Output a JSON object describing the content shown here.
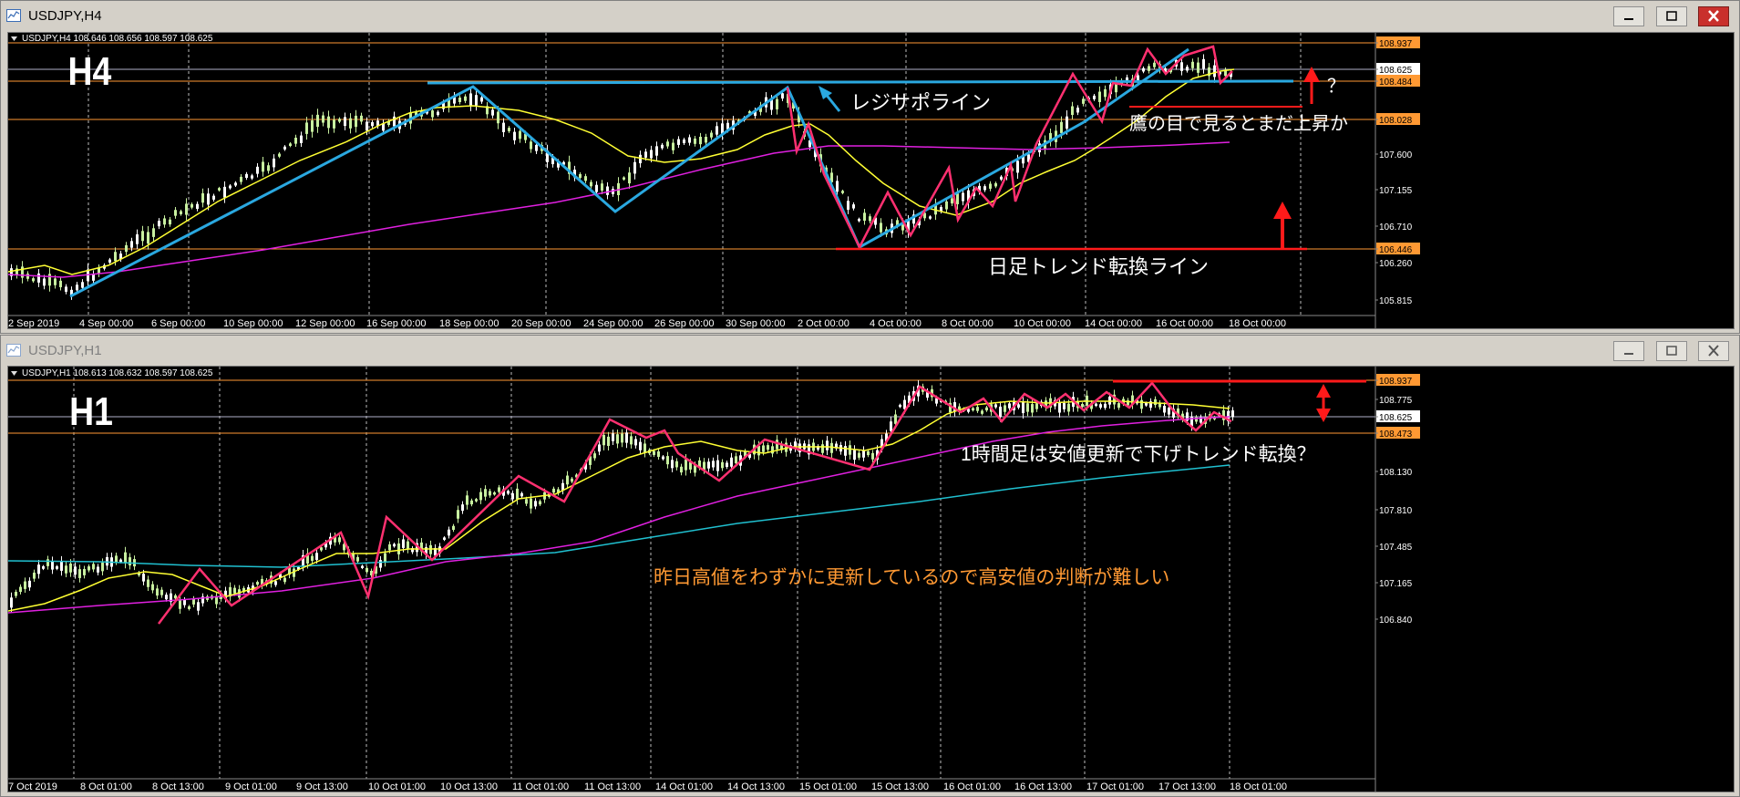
{
  "windows": [
    {
      "title": "USDJPY,H4",
      "header": "USDJPY,H4  108.646 108.656 108.597 108.625",
      "label": "H4",
      "price_labels": [
        "108.937",
        "108.625",
        "108.484",
        "108.028",
        "107.600",
        "107.155",
        "106.710",
        "106.446",
        "106.260",
        "105.815"
      ],
      "time_labels": [
        "2 Sep 2019",
        "4 Sep 00:00",
        "6 Sep 00:00",
        "10 Sep 00:00",
        "12 Sep 00:00",
        "16 Sep 00:00",
        "18 Sep 00:00",
        "20 Sep 00:00",
        "24 Sep 00:00",
        "26 Sep 00:00",
        "30 Sep 00:00",
        "2 Oct 00:00",
        "4 Oct 00:00",
        "8 Oct 00:00",
        "10 Oct 00:00",
        "14 Oct 00:00",
        "16 Oct 00:00",
        "18 Oct 00:00"
      ],
      "annotations": {
        "resistance": "レジサポライン",
        "hawk": "鷹の目で見るとまだ上昇か",
        "question": "？",
        "daily": "日足トレンド転換ライン"
      }
    },
    {
      "title": "USDJPY,H1",
      "header": "USDJPY,H1  108.613 108.632 108.597 108.625",
      "label": "H1",
      "price_labels": [
        "108.937",
        "108.775",
        "108.625",
        "108.473",
        "108.130",
        "107.810",
        "107.485",
        "107.165",
        "106.840"
      ],
      "time_labels": [
        "7 Oct 2019",
        "8 Oct 01:00",
        "8 Oct 13:00",
        "9 Oct 01:00",
        "9 Oct 13:00",
        "10 Oct 01:00",
        "10 Oct 13:00",
        "11 Oct 01:00",
        "11 Oct 13:00",
        "14 Oct 01:00",
        "14 Oct 13:00",
        "15 Oct 01:00",
        "15 Oct 13:00",
        "16 Oct 01:00",
        "16 Oct 13:00",
        "17 Oct 01:00",
        "17 Oct 13:00",
        "18 Oct 01:00"
      ],
      "annotations": {
        "h1note": "1時間足は安値更新で下げトレンド転換？",
        "yesterday": "昨日高値をわずかに更新しているので高安値の判断が難しい"
      }
    }
  ],
  "colors": {
    "background": "#000000",
    "candle_up": "#c8f0a0",
    "candle_down": "#ffffff",
    "ma_yellow": "#ffff33",
    "ma_magenta": "#e020e0",
    "ma_cyan": "#20c0d0",
    "trend_blue": "#2aa8e0",
    "zigzag": "#ff3070",
    "line_red": "#ff1a1a",
    "line_orange": "#ff9933",
    "note_orange": "#ff9933"
  }
}
